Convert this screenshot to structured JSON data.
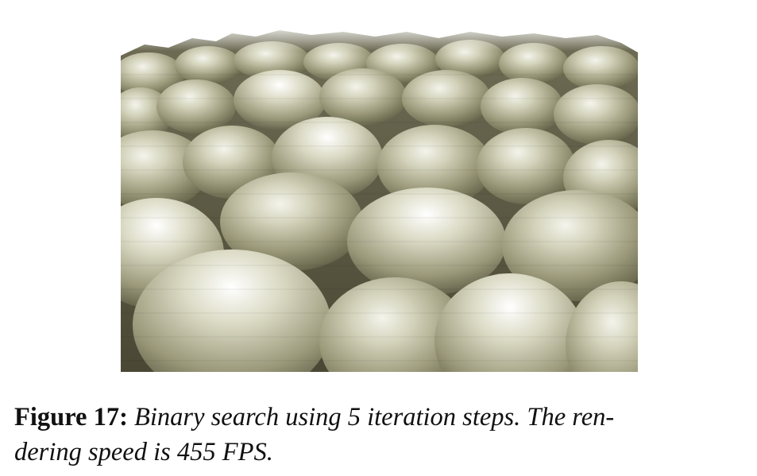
{
  "figure": {
    "image_description_icon": "bump-mapped-terrain-render",
    "colors": {
      "base": "#8f8f6e",
      "highlight": "#f3f3ea",
      "shadow": "#2d2b1d"
    }
  },
  "caption": {
    "label": "Figure 17:",
    "text_line1": "Binary search using 5 iteration steps. The ren-",
    "text_line2": "dering speed is 455 FPS."
  }
}
